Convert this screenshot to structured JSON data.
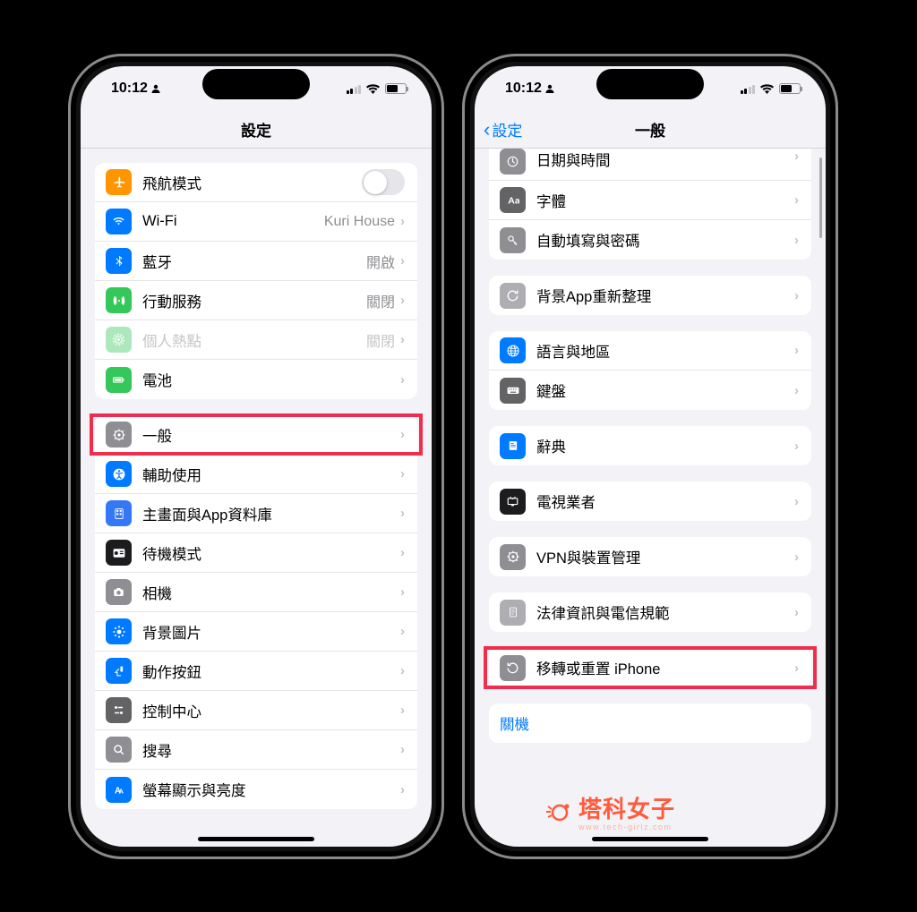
{
  "status": {
    "time": "10:12",
    "user_icon": "person"
  },
  "left": {
    "nav_title": "設定",
    "group1": [
      {
        "icon": "airplane",
        "color": "ic-orange",
        "label": "飛航模式",
        "toggle": true
      },
      {
        "icon": "wifi",
        "color": "ic-blue",
        "label": "Wi-Fi",
        "detail": "Kuri House",
        "chev": true
      },
      {
        "icon": "bluetooth",
        "color": "ic-blue",
        "label": "藍牙",
        "detail": "開啟",
        "chev": true
      },
      {
        "icon": "cellular",
        "color": "ic-green",
        "label": "行動服務",
        "detail": "關閉",
        "chev": true
      },
      {
        "icon": "hotspot",
        "color": "ic-green",
        "label": "個人熱點",
        "detail": "關閉",
        "chev": true,
        "disabled": true
      },
      {
        "icon": "battery",
        "color": "ic-greenbat",
        "label": "電池",
        "chev": true
      }
    ],
    "group2": [
      {
        "icon": "gear",
        "color": "ic-gray",
        "label": "一般",
        "chev": true,
        "highlighted": true
      },
      {
        "icon": "accessibility",
        "color": "ic-blue",
        "label": "輔助使用",
        "chev": true
      },
      {
        "icon": "home",
        "color": "ic-blue2",
        "label": "主畫面與App資料庫",
        "chev": true
      },
      {
        "icon": "standby",
        "color": "ic-black",
        "label": "待機模式",
        "chev": true
      },
      {
        "icon": "camera",
        "color": "ic-gray",
        "label": "相機",
        "chev": true
      },
      {
        "icon": "wallpaper",
        "color": "ic-blue",
        "label": "背景圖片",
        "chev": true
      },
      {
        "icon": "action",
        "color": "ic-blue",
        "label": "動作按鈕",
        "chev": true
      },
      {
        "icon": "control",
        "color": "ic-graydk",
        "label": "控制中心",
        "chev": true
      },
      {
        "icon": "search",
        "color": "ic-gray",
        "label": "搜尋",
        "chev": true
      },
      {
        "icon": "display",
        "color": "ic-blue",
        "label": "螢幕顯示與亮度",
        "chev": true
      }
    ]
  },
  "right": {
    "back_label": "設定",
    "nav_title": "一般",
    "groups": [
      {
        "rows": [
          {
            "icon": "clock",
            "color": "ic-gray",
            "label": "日期與時間",
            "chev": true,
            "cut": true
          },
          {
            "icon": "font",
            "color": "ic-graydk",
            "label": "字體",
            "chev": true
          },
          {
            "icon": "key",
            "color": "ic-gray",
            "label": "自動填寫與密碼",
            "chev": true
          }
        ]
      },
      {
        "rows": [
          {
            "icon": "refresh",
            "color": "ic-graylt",
            "label": "背景App重新整理",
            "chev": true
          }
        ]
      },
      {
        "rows": [
          {
            "icon": "globe",
            "color": "ic-blue",
            "label": "語言與地區",
            "chev": true
          },
          {
            "icon": "keyboard",
            "color": "ic-graydk",
            "label": "鍵盤",
            "chev": true
          }
        ]
      },
      {
        "rows": [
          {
            "icon": "dict",
            "color": "ic-blue",
            "label": "辭典",
            "chev": true
          }
        ]
      },
      {
        "rows": [
          {
            "icon": "tv",
            "color": "ic-black",
            "label": "電視業者",
            "chev": true
          }
        ]
      },
      {
        "rows": [
          {
            "icon": "vpn",
            "color": "ic-gray",
            "label": "VPN與裝置管理",
            "chev": true
          }
        ]
      },
      {
        "rows": [
          {
            "icon": "legal",
            "color": "ic-graylt",
            "label": "法律資訊與電信規範",
            "chev": true
          }
        ]
      },
      {
        "rows": [
          {
            "icon": "reset",
            "color": "ic-gray",
            "label": "移轉或重置 iPhone",
            "chev": true,
            "highlighted": true
          }
        ]
      },
      {
        "rows": [
          {
            "label": "關機",
            "shutdown": true
          }
        ]
      }
    ]
  },
  "watermark": {
    "main": "塔科女子",
    "sub": "www.tech-girlz.com"
  }
}
